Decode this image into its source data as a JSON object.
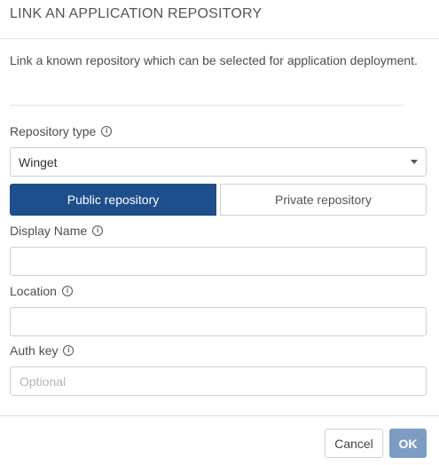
{
  "dialog": {
    "title": "LINK AN APPLICATION REPOSITORY",
    "description": "Link a known repository which can be selected for application deployment."
  },
  "form": {
    "repo_type": {
      "label": "Repository type",
      "value": "Winget",
      "info_icon": "info-icon"
    },
    "visibility": {
      "public_label": "Public repository",
      "private_label": "Private repository",
      "selected": "Public repository"
    },
    "display_name": {
      "label": "Display Name",
      "value": "",
      "placeholder": ""
    },
    "location": {
      "label": "Location",
      "value": "",
      "placeholder": ""
    },
    "auth_key": {
      "label": "Auth key",
      "value": "",
      "placeholder": "Optional"
    }
  },
  "footer": {
    "cancel_label": "Cancel",
    "ok_label": "OK"
  },
  "colors": {
    "primary": "#1f4e8c",
    "ok_disabled": "#7d9cc4"
  }
}
